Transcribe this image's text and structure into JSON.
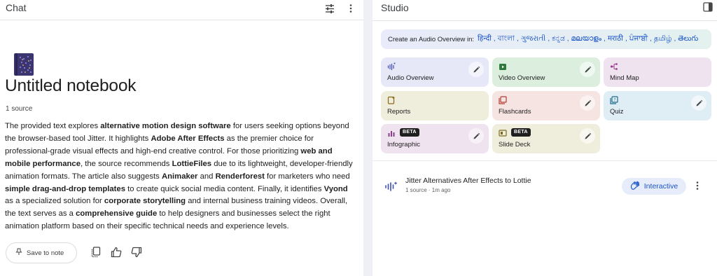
{
  "chat": {
    "title": "Chat",
    "notebook_title": "Untitled notebook",
    "source_count": "1 source",
    "summary": [
      {
        "t": "The provided text explores ",
        "b": false
      },
      {
        "t": "alternative motion design software",
        "b": true
      },
      {
        "t": " for users seeking options beyond the browser-based tool Jitter. It highlights ",
        "b": false
      },
      {
        "t": "Adobe After Effects",
        "b": true
      },
      {
        "t": " as the premier choice for professional-grade visual effects and high-end creative control. For those prioritizing ",
        "b": false
      },
      {
        "t": "web and mobile performance",
        "b": true
      },
      {
        "t": ", the source recommends ",
        "b": false
      },
      {
        "t": "LottieFiles",
        "b": true
      },
      {
        "t": " due to its lightweight, developer-friendly animation formats. The article also suggests ",
        "b": false
      },
      {
        "t": "Animaker",
        "b": true
      },
      {
        "t": " and ",
        "b": false
      },
      {
        "t": "Renderforest",
        "b": true
      },
      {
        "t": " for marketers who need ",
        "b": false
      },
      {
        "t": "simple drag-and-drop templates",
        "b": true
      },
      {
        "t": " to create quick social media content. Finally, it identifies ",
        "b": false
      },
      {
        "t": "Vyond",
        "b": true
      },
      {
        "t": " as a specialized solution for ",
        "b": false
      },
      {
        "t": "corporate storytelling",
        "b": true
      },
      {
        "t": " and internal business training videos. Overall, the text serves as a ",
        "b": false
      },
      {
        "t": "comprehensive guide",
        "b": true
      },
      {
        "t": " to help designers and businesses select the right animation platform based on their specific technical needs and experience levels.",
        "b": false
      }
    ],
    "save_label": "Save to note",
    "icons": {
      "tune": "tune-icon",
      "more": "more-vert-icon",
      "notebook": "notebook-icon",
      "pin": "pin-icon",
      "copy": "copy-icon",
      "thumbs_up": "thumbs-up-icon",
      "thumbs_down": "thumbs-down-icon"
    }
  },
  "studio": {
    "title": "Studio",
    "audio_overview_prompt": "Create an Audio Overview in:",
    "languages": [
      "हिन्दी",
      "বাংলা",
      "ગુજરાતી",
      "ಕನ್ನಡ",
      "മലയാളം",
      "मराठी",
      "ਪੰਜਾਬੀ",
      "தமிழ்",
      "తెలుగు"
    ],
    "tiles": [
      {
        "label": "Audio Overview",
        "icon": "audio-waveform-icon",
        "color": "#e6e8f8",
        "accent": "#3c4cb0",
        "editable": true
      },
      {
        "label": "Video Overview",
        "icon": "video-icon",
        "color": "#dcefdf",
        "accent": "#2d7a3c",
        "editable": true
      },
      {
        "label": "Mind Map",
        "icon": "mind-map-icon",
        "color": "#efe3ef",
        "accent": "#9a3d8e",
        "editable": false
      },
      {
        "label": "Reports",
        "icon": "reports-icon",
        "color": "#efeedd",
        "accent": "#8a6a16",
        "editable": false
      },
      {
        "label": "Flashcards",
        "icon": "flashcards-icon",
        "color": "#f6e4e2",
        "accent": "#b23a30",
        "editable": true
      },
      {
        "label": "Quiz",
        "icon": "quiz-icon",
        "color": "#dfedf4",
        "accent": "#1f6c8c",
        "editable": true
      },
      {
        "label": "Infographic",
        "icon": "infographic-icon",
        "color": "#efe3ef",
        "accent": "#8a3d8a",
        "editable": true,
        "beta": "BETA"
      },
      {
        "label": "Slide Deck",
        "icon": "slide-deck-icon",
        "color": "#efeedd",
        "accent": "#7a6a20",
        "editable": true,
        "beta": "BETA"
      }
    ],
    "note": {
      "title": "Jitter Alternatives After Effects to Lottie",
      "meta": "1 source · 1m ago",
      "action_label": "Interactive",
      "icon": "audio-waveform-icon"
    }
  },
  "colors": {
    "accent_blue": "#1a55c9",
    "divider": "#eef0f6"
  }
}
